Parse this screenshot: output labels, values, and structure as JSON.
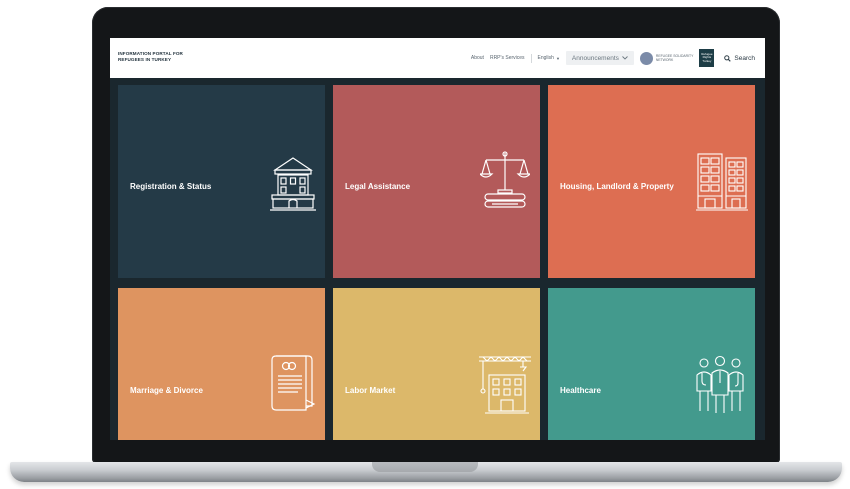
{
  "header": {
    "brand_line1": "INFORMATION PORTAL FOR",
    "brand_line2": "REFUGEES IN TURKEY",
    "nav": {
      "about": "About",
      "services": "RRP's Services",
      "language": "English",
      "announcements": "Announcements",
      "network_line1": "REFUGEE SOLIDARITY",
      "network_line2": "NETWORK",
      "badge": "Refugee Rights Turkey",
      "search": "Search"
    }
  },
  "tiles": [
    {
      "label": "Registration & Status",
      "color": "#243a47",
      "icon": "government-building-icon"
    },
    {
      "label": "Legal Assistance",
      "color": "#b35a5a",
      "icon": "scales-of-justice-icon"
    },
    {
      "label": "Housing, Landlord & Property",
      "color": "#dd6e52",
      "icon": "apartment-buildings-icon"
    },
    {
      "label": "Marriage & Divorce",
      "color": "#de9460",
      "icon": "marriage-certificate-icon"
    },
    {
      "label": "Labor Market",
      "color": "#dcb86a",
      "icon": "construction-crane-icon"
    },
    {
      "label": "Healthcare",
      "color": "#439a8d",
      "icon": "medical-staff-icon"
    }
  ]
}
